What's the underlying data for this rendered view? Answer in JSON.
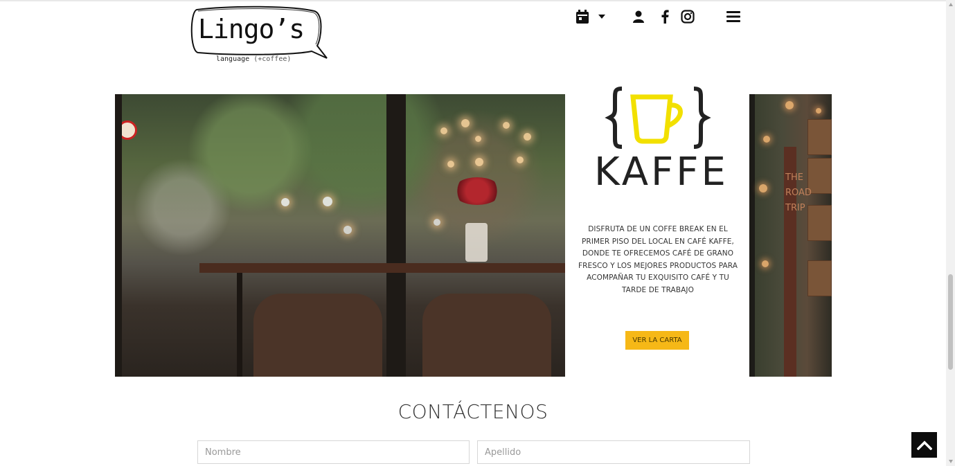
{
  "header": {
    "logo_text": "Lingo’s",
    "logo_sub": "language",
    "logo_sub_paren": "(+coffee)",
    "icons": [
      "calendar-icon",
      "caret-down-icon",
      "user-icon",
      "facebook-icon",
      "instagram-icon",
      "hamburger-menu-icon"
    ]
  },
  "kaffe": {
    "logo_word": "KAFFE",
    "description": "DISFRUTA DE UN COFFE BREAK EN EL PRIMER PISO DEL LOCAL EN CAFÉ KAFFE, DONDE TE OFRECEMOS CAFÉ DE GRANO FRESCO Y LOS MEJORES PRODUCTOS PARA ACOMPAÑAR TU EXQUISITO CAFÉ Y TU TARDE DE TRABAJO",
    "button_label": "VER LA CARTA",
    "accent_color": "#f6b817",
    "cup_color": "#f2e000"
  },
  "side_photo": {
    "sign_text": "THE ROAD TRIP"
  },
  "contact": {
    "title": "CONTÁCTENOS",
    "nombre_placeholder": "Nombre",
    "apellido_placeholder": "Apellido"
  },
  "back_to_top_icon": "chevron-up-icon"
}
